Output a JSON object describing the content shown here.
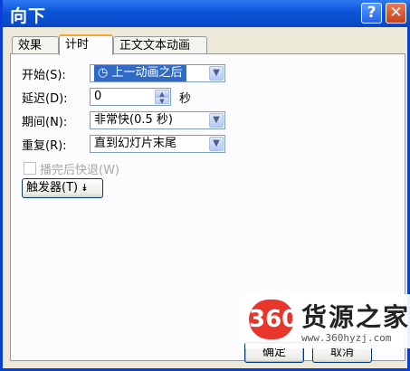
{
  "window": {
    "title": "向下",
    "help_label": "?",
    "close_label": "✕"
  },
  "tabs": [
    {
      "label": "效果"
    },
    {
      "label": "计时"
    },
    {
      "label": "正文文本动画"
    }
  ],
  "form": {
    "start_label": "开始(S):",
    "start_value": "上一动画之后",
    "start_icon": "clock-icon",
    "delay_label": "延迟(D):",
    "delay_value": "0",
    "delay_unit": "秒",
    "duration_label": "期间(N):",
    "duration_value": "非常快(0.5 秒)",
    "repeat_label": "重复(R):",
    "repeat_value": "直到幻灯片末尾",
    "rewind_label": "播完后快退(W)",
    "trigger_label": "触发器(T)"
  },
  "buttons": {
    "ok": "确定",
    "cancel": "取消"
  },
  "watermark": {
    "logo": "360",
    "name": "货源之家",
    "url": "www.360hyzj.com"
  }
}
